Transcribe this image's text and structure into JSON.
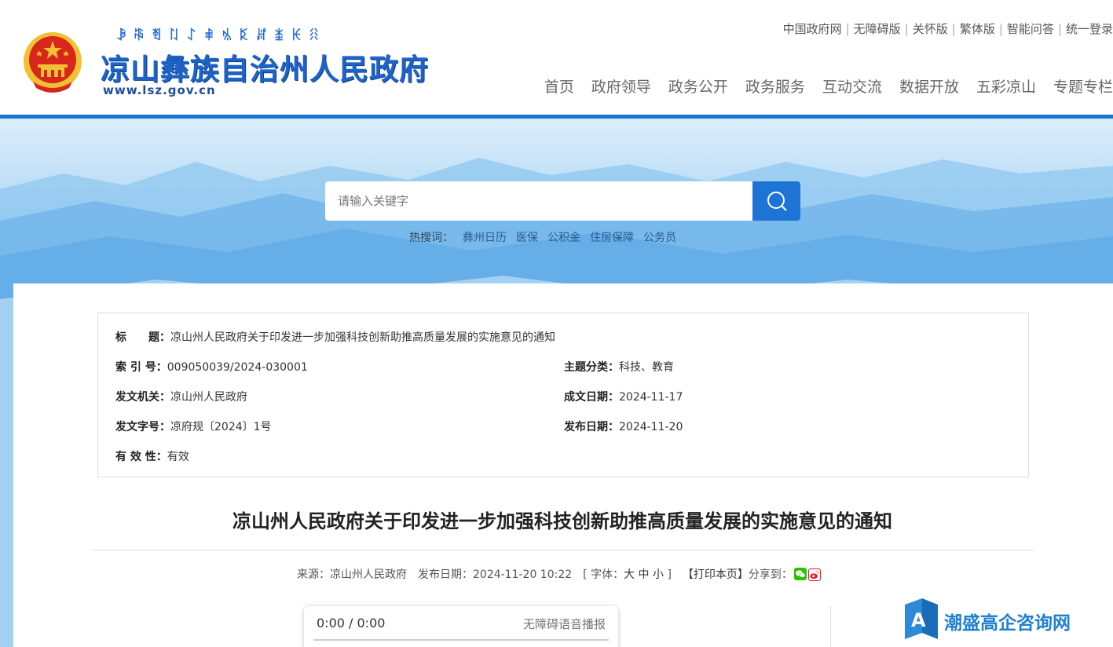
{
  "header": {
    "yi_title": "ꆃꎸꄮꇁꋍꑌꁱꌅꏦꁧꀘꋧ",
    "title": "凉山彝族自治州人民政府",
    "url": "www.lsz.gov.cn",
    "top_links": [
      "中国政府网",
      "无障碍版",
      "关怀版",
      "繁体版",
      "智能问答",
      "统一登录"
    ],
    "nav": [
      "首页",
      "政府领导",
      "政务公开",
      "政务服务",
      "互动交流",
      "数据开放",
      "五彩凉山",
      "专题专栏"
    ]
  },
  "search": {
    "placeholder": "请输入关键字",
    "hot_label": "热搜词：",
    "hot_words": [
      "彝州日历",
      "医保",
      "公积金",
      "住房保障",
      "公务员"
    ]
  },
  "meta": {
    "title_label": "标　　题：",
    "title_value": "凉山州人民政府关于印发进一步加强科技创新助推高质量发展的实施意见的通知",
    "index_label": "索 引 号：",
    "index_value": "009050039/2024-030001",
    "topic_label": "主题分类：",
    "topic_value": "科技、教育",
    "issuer_label": "发文机关：",
    "issuer_value": "凉山州人民政府",
    "written_label": "成文日期：",
    "written_value": "2024-11-17",
    "docno_label": "发文字号：",
    "docno_value": "凉府规〔2024〕1号",
    "pub_label": "发布日期：",
    "pub_value": "2024-11-20",
    "valid_label": "有 效 性：",
    "valid_value": "有效"
  },
  "article": {
    "title": "凉山州人民政府关于印发进一步加强科技创新助推高质量发展的实施意见的通知",
    "source_label": "来源：",
    "source_value": "凉山州人民政府",
    "date_label": "发布日期：",
    "date_value": "2024-11-20 10:22",
    "font_label": "[ 字体：",
    "font_big": "大",
    "font_mid": "中",
    "font_small": "小",
    "font_close": " ]",
    "print": "【打印本页】",
    "share_label": "分享到："
  },
  "audio": {
    "time": "0:00 / 0:00",
    "accessible_label": "无障碍语音播报"
  },
  "watermark": {
    "text": "潮盛高企咨询网",
    "logo_letter": "A"
  },
  "colors": {
    "brand_blue": "#1e74d4",
    "title_blue": "#1e64c8",
    "emblem_red": "#d8261c",
    "emblem_gold": "#f2c133"
  }
}
